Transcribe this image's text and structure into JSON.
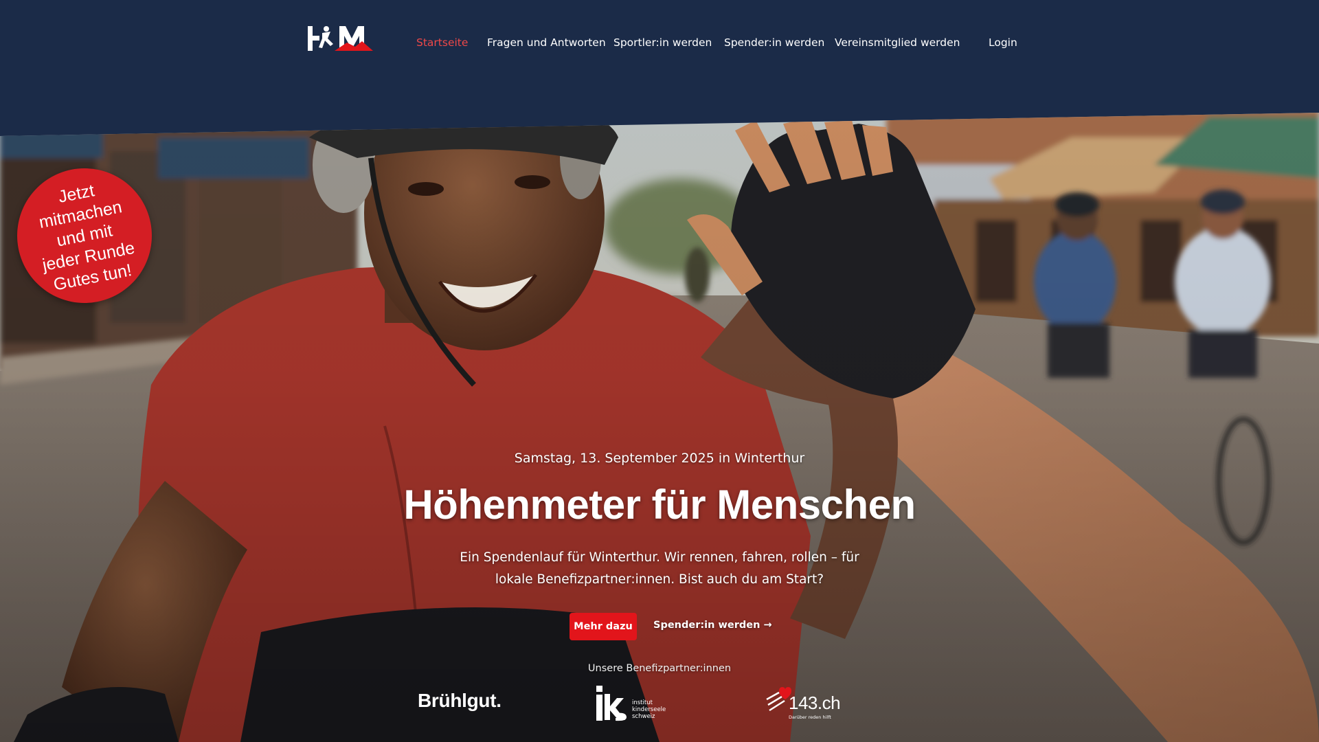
{
  "header": {
    "logo_text": "HöM",
    "nav": [
      {
        "label": "Startseite",
        "active": true
      },
      {
        "label": "Fragen und Antworten",
        "active": false
      },
      {
        "label": "Sportler:in werden",
        "active": false
      },
      {
        "label": "Spender:in werden",
        "active": false
      },
      {
        "label": "Vereinsmitglied werden",
        "active": false
      }
    ],
    "login_label": "Login"
  },
  "badge": {
    "text": "Jetzt\nmitmachen\nund mit\njeder Runde\nGutes tun!"
  },
  "hero": {
    "eyebrow": "Samstag, 13. September 2025 in Winterthur",
    "title": "Höhenmeter für Menschen",
    "lead": "Ein Spendenlauf für Winterthur. Wir rennen, fahren, rollen – für lokale Benefizpartner:innen. Bist auch du am Start?",
    "primary_button": "Mehr dazu",
    "secondary_link": "Spender:in werden →"
  },
  "partners": {
    "label": "Unsere Benefizpartner:innen",
    "items": [
      {
        "name": "Brühlgut."
      },
      {
        "name": "iks",
        "subtitle": "institut\nkinderseele\nschweiz"
      },
      {
        "name": "143.ch",
        "tagline": "Darüber reden hilft"
      }
    ]
  },
  "colors": {
    "header_bg": "#1b2b48",
    "accent_red": "#e2151b",
    "nav_active": "#ef4848",
    "badge_red": "#d41e24"
  },
  "icons": [
    "runner-logo-icon",
    "heart-icon"
  ]
}
